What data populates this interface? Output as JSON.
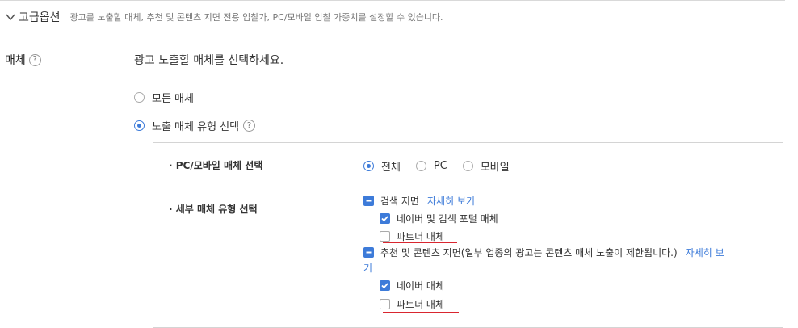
{
  "advanced": {
    "title": "고급옵션",
    "description": "광고를 노출할 매체, 추천 및 콘텐츠 지면 전용 입찰가, PC/모바일 입찰 가중치를 설정할 수 있습니다."
  },
  "media": {
    "label": "매체",
    "help": "?",
    "instruction": "광고 노출할 매체를 선택하세요.",
    "option_all": "모든 매체",
    "option_type": "노출 매체 유형 선택",
    "option_type_selected": true
  },
  "pc_mobile": {
    "label": "· PC/모바일 매체 선택",
    "options": [
      "전체",
      "PC",
      "모바일"
    ],
    "selected": "전체"
  },
  "detail": {
    "label": "· 세부 매체 유형 선택",
    "search": {
      "label": "검색 지면",
      "link": "자세히 보기",
      "items": [
        {
          "label": "네이버 및 검색 포털 매체",
          "checked": true
        },
        {
          "label": "파트너 매체",
          "checked": false
        }
      ]
    },
    "content": {
      "label": "추천 및 콘텐츠 지면(일부 업종의 광고는 콘텐츠 매체 노출이 제한됩니다.)",
      "link_part1": "자세히 보",
      "link_part2": "기",
      "items": [
        {
          "label": "네이버 매체",
          "checked": true
        },
        {
          "label": "파트너 매체",
          "checked": false
        }
      ]
    }
  },
  "colors": {
    "accent": "#3d7bd9",
    "underline": "#d9262f"
  },
  "icons": {
    "chevron": "chevron-down-icon",
    "help": "help-circle-icon",
    "check": "check-icon",
    "indeterminate": "minus-icon"
  }
}
